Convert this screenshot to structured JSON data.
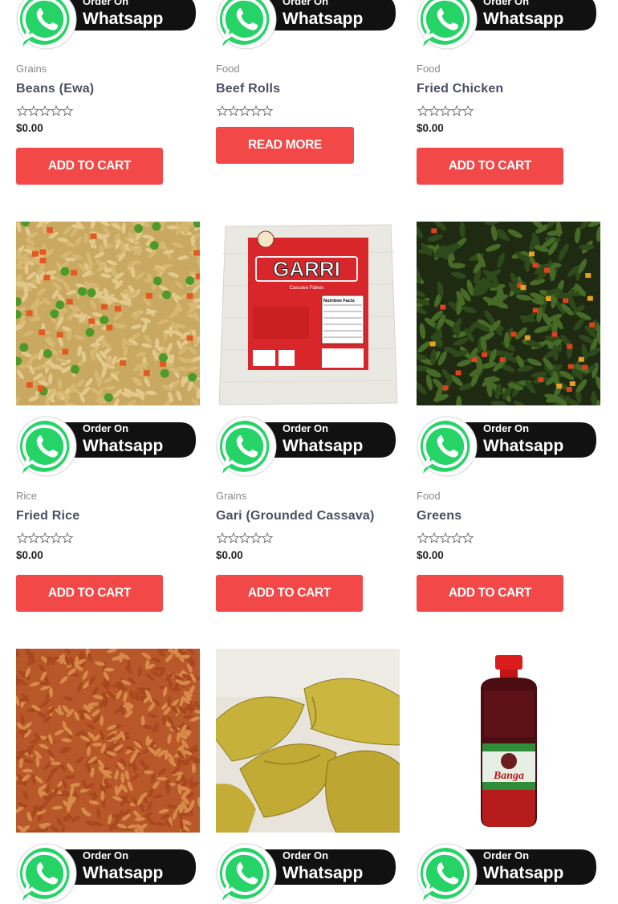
{
  "whatsapp_banner": {
    "line1": "Order On",
    "line2": "Whatsapp"
  },
  "currency_symbol": "$",
  "products": [
    {
      "category": "Grains",
      "title": "Beans (Ewa)",
      "price": "0.00",
      "button": "ADD TO CART",
      "rating": 0
    },
    {
      "category": "Food",
      "title": "Beef Rolls",
      "price": "",
      "button": "READ MORE",
      "rating": 0
    },
    {
      "category": "Food",
      "title": "Fried Chicken",
      "price": "0.00",
      "button": "ADD TO CART",
      "rating": 0
    },
    {
      "category": "Rice",
      "title": "Fried Rice",
      "price": "0.00",
      "button": "ADD TO CART",
      "rating": 0
    },
    {
      "category": "Grains",
      "title": "Gari (Grounded Cassava)",
      "price": "0.00",
      "button": "ADD TO CART",
      "rating": 0
    },
    {
      "category": "Food",
      "title": "Greens",
      "price": "0.00",
      "button": "ADD TO CART",
      "rating": 0
    }
  ],
  "product_images": {
    "garri": {
      "brand": "GARRI",
      "subtitle": "Cassava Flakes",
      "panel_title": "Nutrition Facts"
    },
    "palm_oil": {
      "brand": "Banga"
    }
  },
  "colors": {
    "button": "#f24848",
    "whatsapp_green": "#25d366",
    "banner_bg": "#111111"
  }
}
